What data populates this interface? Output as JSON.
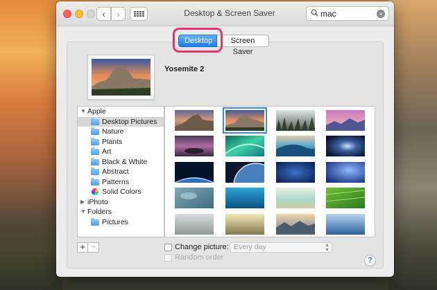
{
  "window": {
    "title": "Desktop & Screen Saver"
  },
  "search": {
    "value": "mac"
  },
  "tabs": {
    "desktop": "Desktop",
    "screen_saver": "Screen Saver"
  },
  "current_wallpaper": {
    "name": "Yosemite 2"
  },
  "sidebar": {
    "apple": "Apple",
    "items": [
      "Desktop Pictures",
      "Nature",
      "Plants",
      "Art",
      "Black & White",
      "Abstract",
      "Patterns",
      "Solid Colors"
    ],
    "iphoto": "iPhoto",
    "folders": "Folders",
    "pictures": "Pictures"
  },
  "options": {
    "change_picture": "Change picture:",
    "interval": "Every day",
    "random_order": "Random order"
  },
  "controls": {
    "add": "+",
    "remove": "−",
    "help": "?"
  },
  "thumbnails": [
    "yosemite-dusk",
    "yosemite-2",
    "forest-fog",
    "purple-sky-mountains",
    "purple-rocks-sea",
    "green-wave",
    "blue-ocean-wave",
    "galaxy",
    "earth-horizon",
    "earth-from-orbit",
    "blue-starfield",
    "blue-nebula",
    "ice-clouds",
    "underwater-blue",
    "white-sand",
    "green-fields",
    "hazy-landscape",
    "sunbeams-field",
    "misty-lake-mountains",
    "blue-hills-haze"
  ],
  "colors": {
    "accent": "#1a7cf0",
    "highlight_ring": "#e8336d"
  }
}
